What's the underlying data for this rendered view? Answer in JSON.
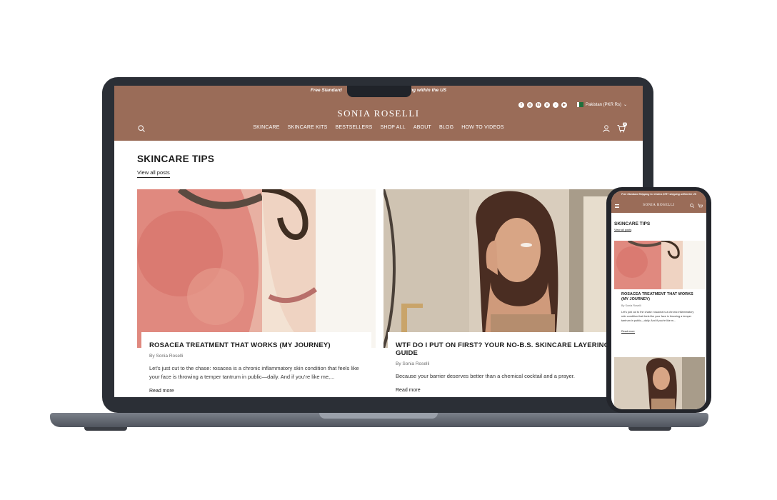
{
  "colors": {
    "header_bg": "#9a6c58",
    "text": "#1c1c1c"
  },
  "site": {
    "announcement": "Free Standard Shipping for Orders $75+ shipping within the US",
    "announcement_left": "Free Standard",
    "announcement_right": "ng within the US",
    "brand": "SONIA  ROSELLI",
    "country": "Pakistan (PKR Rs)",
    "socials": [
      "facebook-icon",
      "instagram-icon",
      "linkedin-icon",
      "pinterest-icon",
      "tiktok-icon",
      "youtube-icon"
    ],
    "cart_count": "0",
    "nav": [
      "SKINCARE",
      "SKINCARE KITS",
      "BESTSELLERS",
      "SHOP ALL",
      "ABOUT",
      "BLOG",
      "HOW TO VIDEOS"
    ]
  },
  "blog": {
    "title": "SKINCARE TIPS",
    "view_all": "View all posts",
    "posts": [
      {
        "title": "ROSACEA TREATMENT THAT WORKS (MY JOURNEY)",
        "author": "By Sonia Roselli",
        "excerpt": "Let's just cut to the chase: rosacea is a chronic inflammatory skin condition that feels like your face is throwing a temper tantrum in public—daily. And if you're like me,...",
        "link": "Read more"
      },
      {
        "title": "WTF DO I PUT ON FIRST? YOUR NO-B.S. SKINCARE LAYERING GUIDE",
        "author": "By Sonia Roselli",
        "excerpt": "Because your barrier deserves better than a chemical cocktail and a prayer.",
        "link": "Read more"
      }
    ]
  },
  "phone": {
    "announcement": "Free Standard Shipping for Orders $75+ shipping within the US",
    "brand": "SONIA  ROSELLI",
    "title": "SKINCARE TIPS",
    "view_all": "View all posts",
    "post_title": "ROSACEA TREATMENT THAT WORKS (MY JOURNEY)",
    "post_author": "By Sonia Roselli",
    "post_excerpt": "Let's just cut to the chase: rosacea is a chronic inflammatory skin condition that feels like your face is throwing a temper tantrum in public—daily. And if you're like m...",
    "post_link": "Read more"
  }
}
